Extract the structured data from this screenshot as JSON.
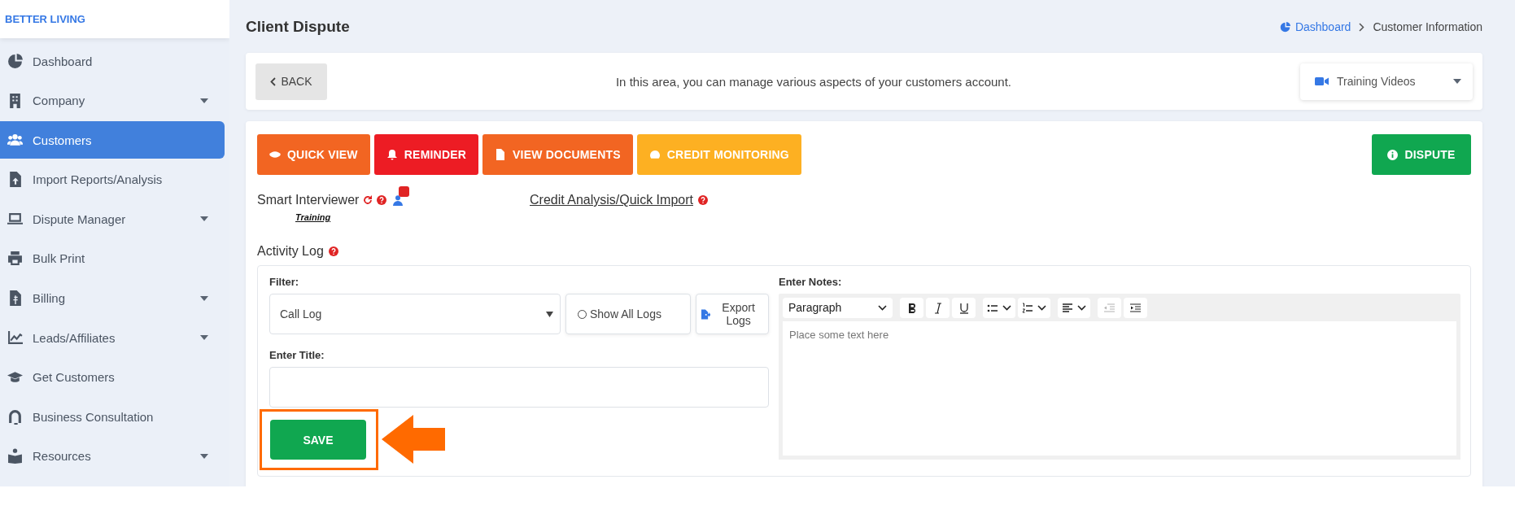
{
  "sidebar": {
    "logo": "BETTER LIVING",
    "items": [
      {
        "label": "Dashboard",
        "selected": false,
        "expandable": false
      },
      {
        "label": "Company",
        "selected": false,
        "expandable": true
      },
      {
        "label": "Customers",
        "selected": true,
        "expandable": false
      },
      {
        "label": "Import Reports/Analysis",
        "selected": false,
        "expandable": false
      },
      {
        "label": "Dispute Manager",
        "selected": false,
        "expandable": true
      },
      {
        "label": "Bulk Print",
        "selected": false,
        "expandable": false
      },
      {
        "label": "Billing",
        "selected": false,
        "expandable": true
      },
      {
        "label": "Leads/Affiliates",
        "selected": false,
        "expandable": true
      },
      {
        "label": "Get Customers",
        "selected": false,
        "expandable": false
      },
      {
        "label": "Business Consultation",
        "selected": false,
        "expandable": false
      },
      {
        "label": "Resources",
        "selected": false,
        "expandable": true
      }
    ]
  },
  "page": {
    "title": "Client Dispute",
    "breadcrumb": [
      "Dashboard",
      "Customer Information"
    ]
  },
  "info_bar": {
    "back": "BACK",
    "message": "In this area, you can manage various aspects of your customers account.",
    "training_videos": "Training Videos"
  },
  "actions": [
    {
      "label": "QUICK VIEW",
      "color": "#f26522"
    },
    {
      "label": "REMINDER",
      "color": "#ed1c24"
    },
    {
      "label": "VIEW DOCUMENTS",
      "color": "#f26522"
    },
    {
      "label": "CREDIT MONITORING",
      "color": "#fdb022"
    }
  ],
  "dispute_button": "DISPUTE",
  "smart_interviewer": {
    "label": "Smart Interviewer",
    "training": "Training"
  },
  "credit_analysis": "Credit Analysis/Quick Import",
  "activity_log": {
    "label": "Activity Log",
    "filter_label": "Filter:",
    "filter_value": "Call Log",
    "show_all": {
      "label": "Show All Logs",
      "checked": false
    },
    "export": "Export Logs",
    "title_label": "Enter Title:",
    "save": "SAVE",
    "notes": {
      "label": "Enter Notes:",
      "block_format": "Paragraph",
      "placeholder": "Place some text here",
      "tools": [
        {
          "kind": "bold",
          "disabled": false
        },
        {
          "kind": "italic",
          "disabled": false
        },
        {
          "kind": "underline",
          "disabled": false
        },
        {
          "kind": "bullets",
          "disabled": false
        },
        {
          "kind": "numbers",
          "disabled": false
        },
        {
          "kind": "align",
          "disabled": false
        },
        {
          "kind": "outdent",
          "disabled": true
        },
        {
          "kind": "indent",
          "disabled": false
        }
      ]
    }
  }
}
